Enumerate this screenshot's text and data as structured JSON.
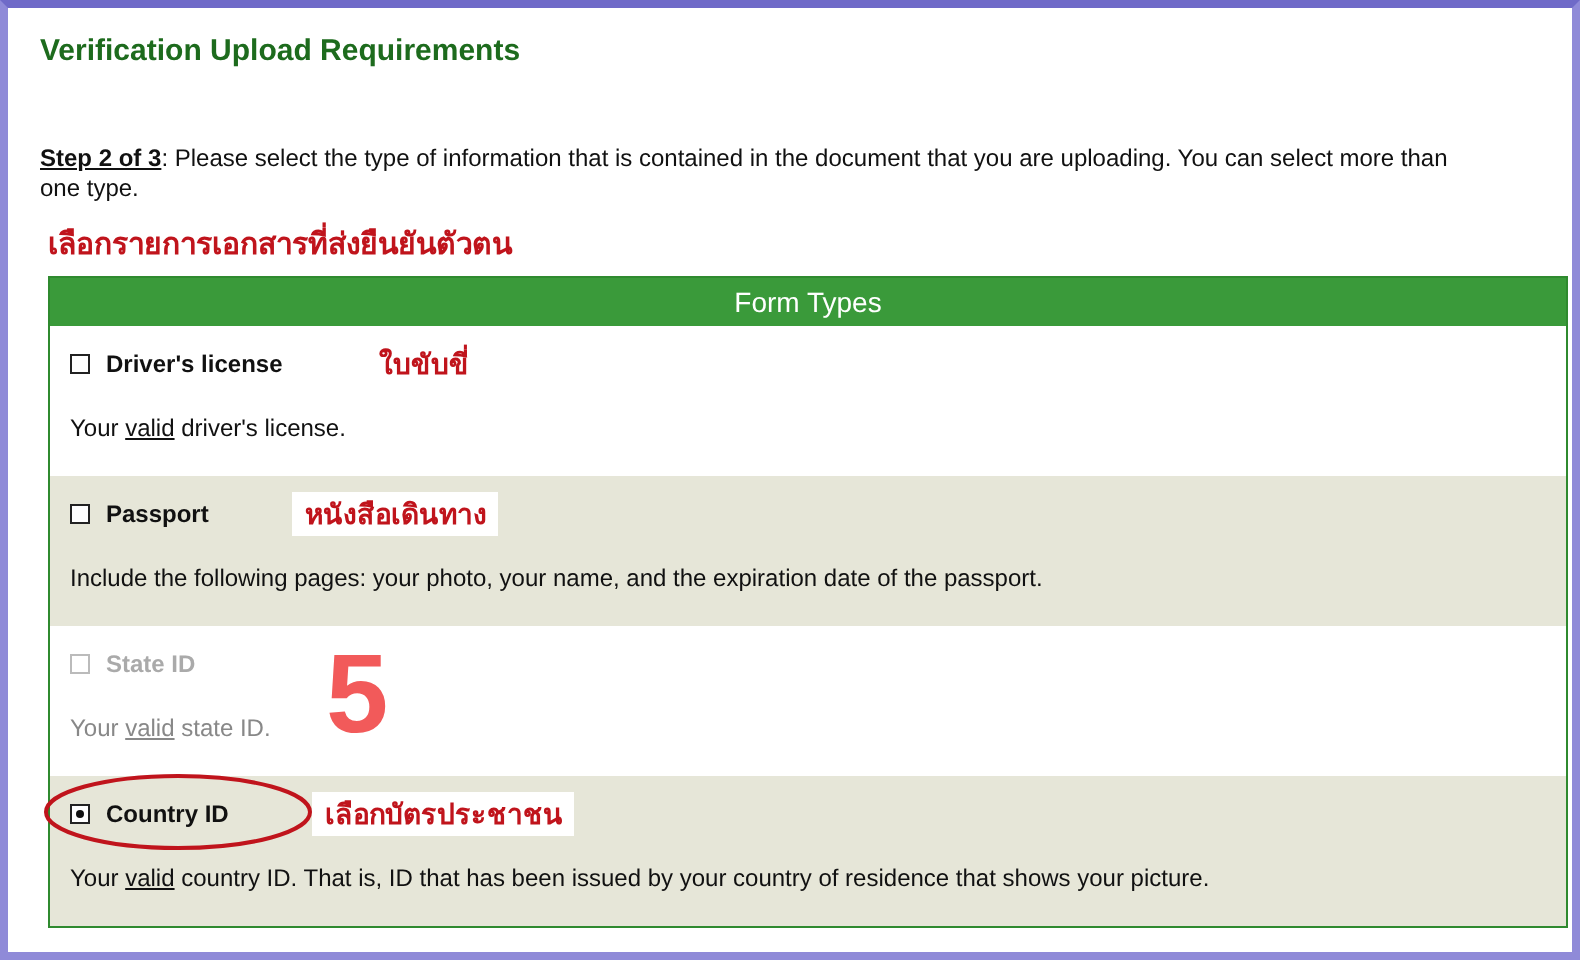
{
  "title": "Verification Upload Requirements",
  "step": {
    "label": "Step 2 of 3",
    "text": ": Please select the type of information that is contained in the document that you are uploading. You can select more than one type."
  },
  "annotation_heading": "เลือกรายการเอกสารที่ส่งยืนยันตัวตน",
  "table": {
    "header": "Form Types",
    "rows": [
      {
        "label": "Driver's license",
        "checked": false,
        "disabled": false,
        "circled": false,
        "note": "ใบขับขี่",
        "description": {
          "lead": "Your ",
          "link": "valid",
          "tail": " driver's license."
        }
      },
      {
        "label": "Passport",
        "checked": false,
        "disabled": false,
        "circled": false,
        "note": "หนังสือเดินทาง",
        "description": {
          "lead": "Include the following pages: your photo, your name, and the expiration date of the passport."
        }
      },
      {
        "label": "State ID",
        "checked": false,
        "disabled": true,
        "circled": false,
        "note": "5",
        "description": {
          "lead": "Your ",
          "link": "valid",
          "tail": " state ID."
        }
      },
      {
        "label": "Country ID",
        "checked": true,
        "disabled": false,
        "circled": true,
        "note": "เลือกบัตรประชาชน",
        "description": {
          "lead": "Your ",
          "link": "valid",
          "tail": " country ID. That is, ID that has been issued by your country of residence that shows your picture."
        }
      }
    ]
  }
}
